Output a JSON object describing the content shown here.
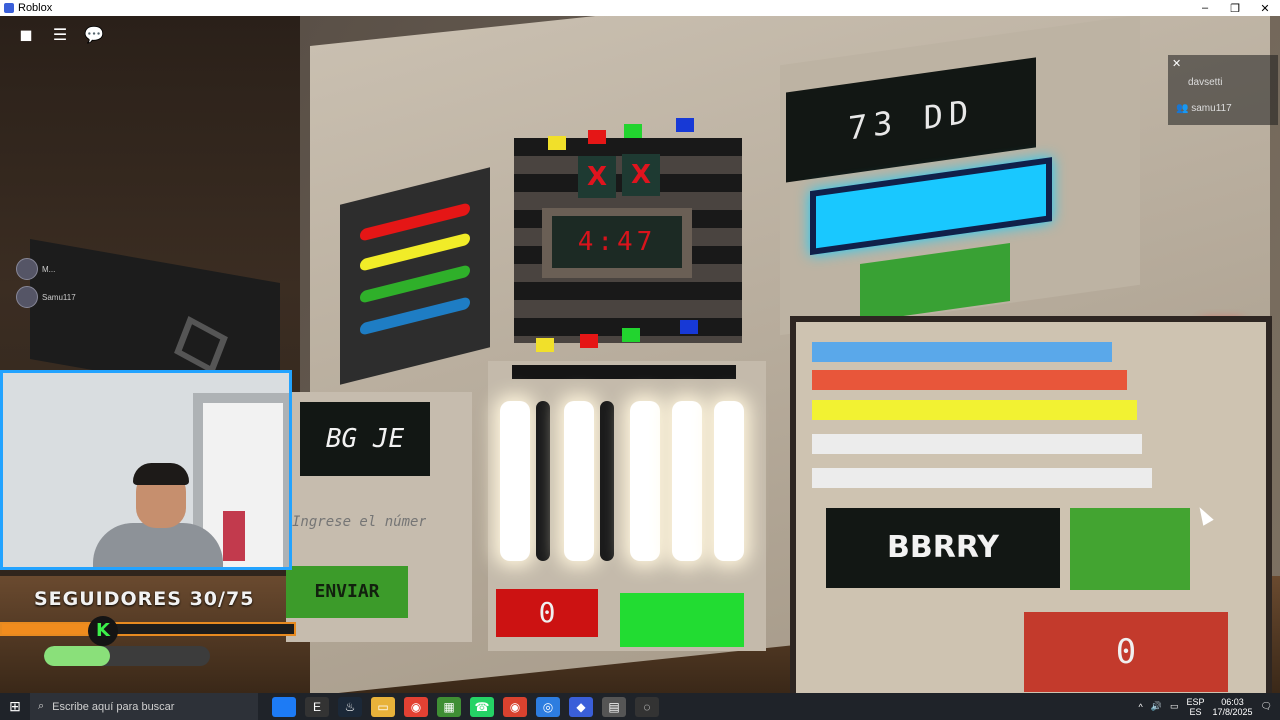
{
  "window": {
    "title": "Roblox",
    "minimize": "–",
    "maximize": "❐",
    "close": "✕"
  },
  "roblox_ui": {
    "menu_icon": "roblox-logo",
    "hamburger": "☰",
    "chat": "💬"
  },
  "player_list": {
    "close": "✕",
    "player1": "davsetti",
    "player2": "samu117"
  },
  "mini_players": [
    "M...",
    "Samu117"
  ],
  "bomb": {
    "x1": "X",
    "x2": "X",
    "timer": "4:47"
  },
  "code_panel": {
    "code": "73 DD"
  },
  "input_panel": {
    "code": "BG JE",
    "placeholder": "Ingrese el número",
    "submit": "ENVIAR"
  },
  "lights_panel": {
    "counter": "0"
  },
  "color_panel": {
    "word": "BBRRY",
    "counter": "0",
    "stripes": [
      "#5aa8ea",
      "#e8563a",
      "#f2f232",
      "#ececec",
      "#ececec"
    ]
  },
  "overlay": {
    "followers_text": "SEGUIDORES 30/75",
    "kick_icon": "K",
    "followers_progress": 0.4
  },
  "taskbar": {
    "search_placeholder": "Escribe aquí para buscar",
    "lang_top": "ESP",
    "lang_bottom": "ES",
    "time": "06:03",
    "date": "17/8/2025"
  }
}
